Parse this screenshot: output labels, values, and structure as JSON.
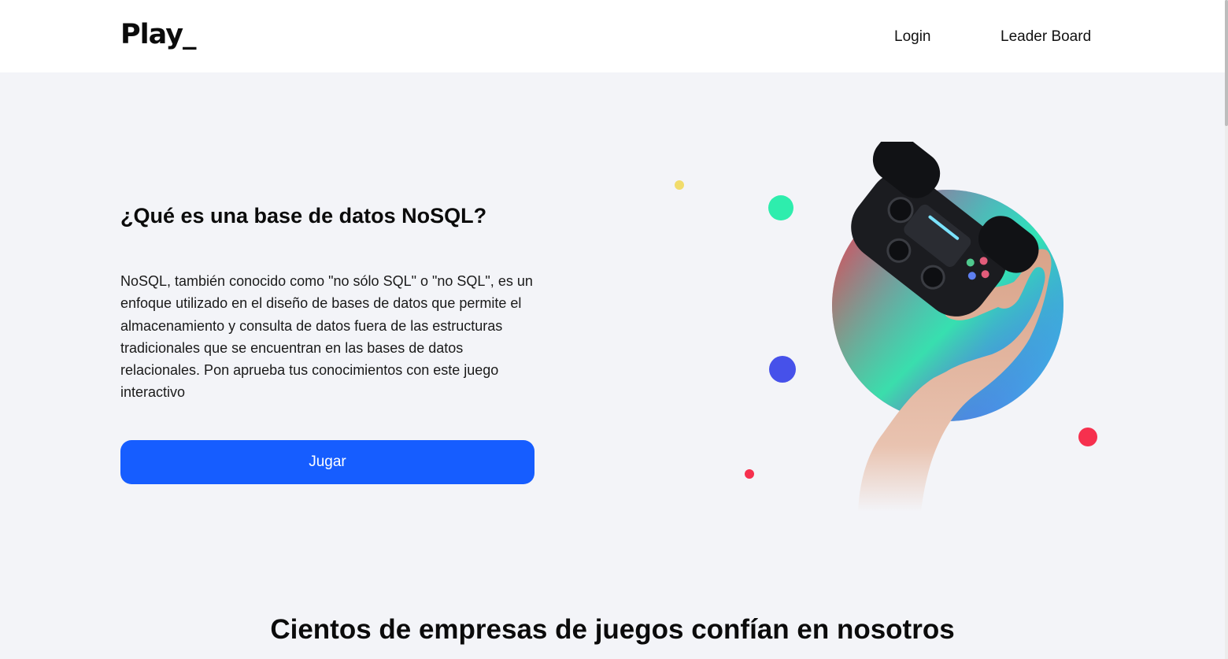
{
  "header": {
    "logo": "Play_",
    "nav": {
      "login": "Login",
      "leaderboard": "Leader Board"
    }
  },
  "hero": {
    "title": "¿Qué es una base de datos NoSQL?",
    "description": "NoSQL, también conocido como \"no sólo SQL\" o \"no SQL\", es un enfoque utilizado en el diseño de bases de datos que permite el almacenamiento y consulta de datos fuera de las estructuras tradicionales que se encuentran en las bases de datos relacionales. Pon aprueba tus conocimientos con este juego interactivo",
    "cta_label": "Jugar",
    "illustration": "hand-holding-gamepad"
  },
  "companies": {
    "title": "Cientos de empresas de juegos confían en nosotros"
  },
  "colors": {
    "primary": "#165dff",
    "background": "#f3f4f8",
    "dot_yellow": "#f1dc6c",
    "dot_green": "#2eedad",
    "dot_blue": "#4651ea",
    "dot_red": "#f6304e"
  }
}
